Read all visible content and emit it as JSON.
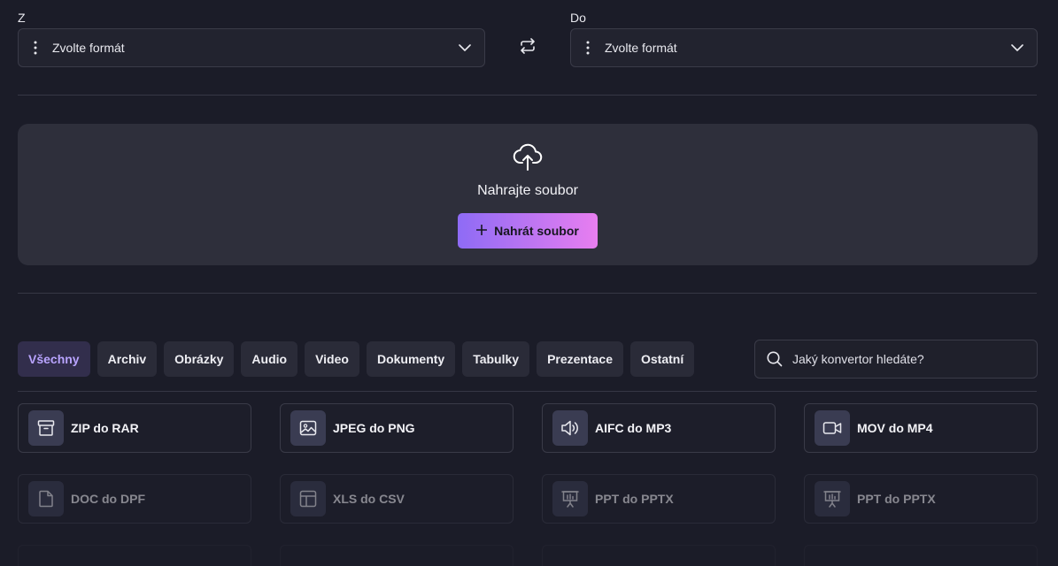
{
  "from": {
    "label": "Z",
    "placeholder": "Zvolte formát"
  },
  "to": {
    "label": "Do",
    "placeholder": "Zvolte formát"
  },
  "upload": {
    "title": "Nahrajte soubor",
    "button_label": "Nahrát soubor"
  },
  "filters": [
    {
      "label": "Všechny",
      "active": true
    },
    {
      "label": "Archiv"
    },
    {
      "label": "Obrázky"
    },
    {
      "label": "Audio"
    },
    {
      "label": "Video"
    },
    {
      "label": "Dokumenty"
    },
    {
      "label": "Tabulky"
    },
    {
      "label": "Prezentace"
    },
    {
      "label": "Ostatní"
    }
  ],
  "search": {
    "placeholder": "Jaký konvertor hledáte?"
  },
  "converters": [
    {
      "label": "ZIP do RAR",
      "icon": "archive-icon"
    },
    {
      "label": "JPEG do PNG",
      "icon": "image-icon"
    },
    {
      "label": "AIFC do MP3",
      "icon": "speaker-icon"
    },
    {
      "label": "MOV do MP4",
      "icon": "video-camera-icon"
    },
    {
      "label": "DOC do DPF",
      "icon": "document-icon"
    },
    {
      "label": "XLS do CSV",
      "icon": "table-icon"
    },
    {
      "label": "PPT do PPTX",
      "icon": "presentation-icon"
    },
    {
      "label": "PPT do PPTX",
      "icon": "presentation-icon"
    }
  ],
  "colors": {
    "background": "#1b1c28",
    "accent_gradient_start": "#8e6bf5",
    "accent_gradient_end": "#e87ef0",
    "active_filter_text": "#b9a4ff"
  }
}
